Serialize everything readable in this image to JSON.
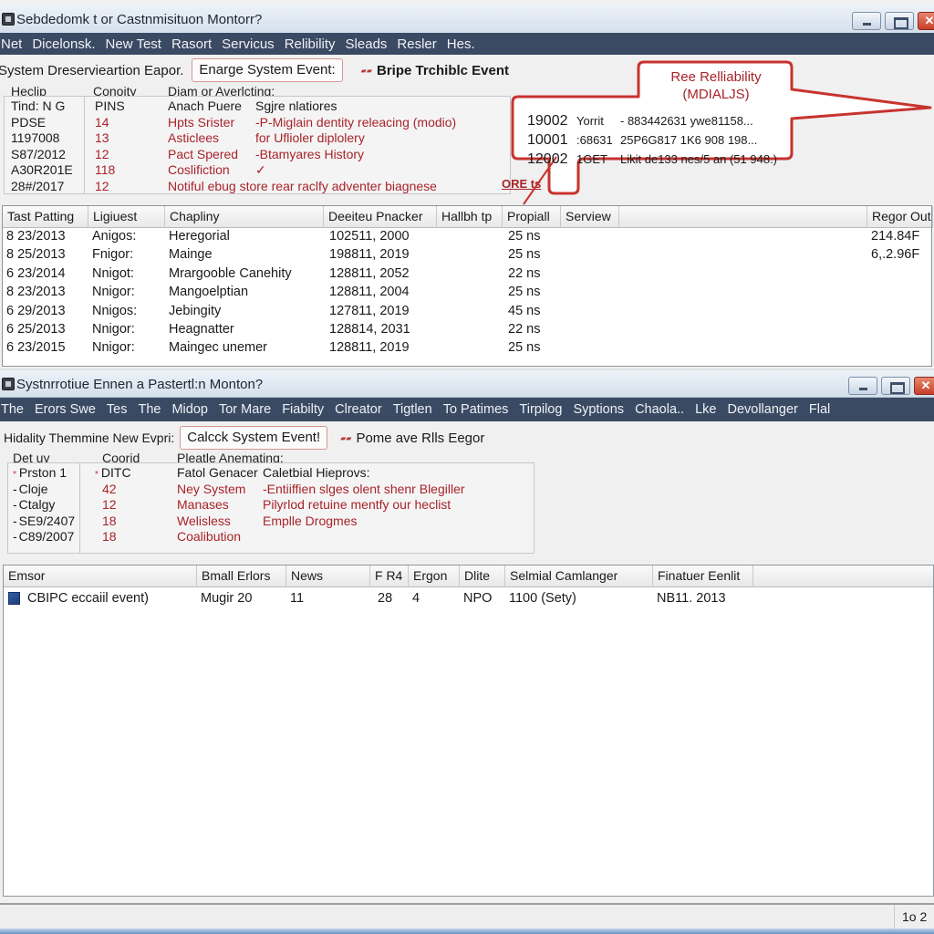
{
  "window1": {
    "title": "Sebdedomk t or Castnmisituon Montorr?",
    "menu": [
      "Net",
      "Dicelonsk.",
      "New Test",
      "Rasort",
      "Servicus",
      "Relibility",
      "Sleads",
      "Resler",
      "Hes."
    ],
    "toolbar": {
      "label": "System Dreservieartion Eapor.",
      "button": "Enarge System Event:",
      "link": "Bripe Trchiblc Event"
    },
    "summary": {
      "headers": [
        "Heclip",
        "Conoity",
        "Diam or Averlcting:"
      ],
      "rows": [
        {
          "c1": "Tind: N G",
          "c2": "PINS",
          "c3": "Anach Puere",
          "c4": "Sgjre nlatiores",
          "red": false
        },
        {
          "c1": "PDSE",
          "c2": "14",
          "c3": "Hpts Srister",
          "c4": "-P-Miglain dentity releacing (modio)",
          "red": true
        },
        {
          "c1": "1197008",
          "c2": "13",
          "c3": "Asticlees",
          "c4": "for Uflioler diplolery",
          "red": true
        },
        {
          "c1": "S87/2012",
          "c2": "12",
          "c3": "Pact Spered",
          "c4": "-Btamyares History",
          "red": true
        },
        {
          "c1": "A30R201E",
          "c2": "118",
          "c3": "Coslifiction",
          "c4": "✓",
          "red": true
        },
        {
          "c1": "28#/2017",
          "c2": "12",
          "c3": "Notiful ebug store rear raclfy adventer biagnese",
          "c4": "",
          "red": true
        }
      ],
      "link_text": "ORE ts"
    },
    "callout": {
      "title": "Ree Relliability",
      "subtitle": "(MDIALJS)",
      "lines": [
        {
          "id": "19002",
          "a": "Yorrit",
          "b": "- 883442631 ywe81158..."
        },
        {
          "id": "10001",
          "a": ":68631",
          "b": "25P6G817 1K6 908 198..."
        },
        {
          "id": "12002",
          "a": "1GET",
          "b": "Likit de133 nes/5 an (51 948.)"
        }
      ]
    },
    "table": {
      "columns": [
        "Tast Patting",
        "Ligiuest",
        "Chapliny",
        "Deeiteu Pnacker",
        "Hallbh tp",
        "Propiall",
        "Serview",
        "",
        "Regor Out"
      ],
      "rows": [
        [
          "8 23/2013",
          "Anigos:",
          "Heregorial",
          "102511, 2000",
          "",
          "25 ns",
          "",
          "",
          "214.84F"
        ],
        [
          "8 25/2013",
          "Fnigor:",
          "Mainge",
          "198811, 2019",
          "",
          "25 ns",
          "",
          "",
          "6,.2.96F"
        ],
        [
          "6 23/2014",
          "Nnigot:",
          "Mrargooble Canehity",
          "128811, 2052",
          "",
          "22 ns",
          "",
          "",
          ""
        ],
        [
          "8 23/2013",
          "Nnigor:",
          "Mangoelptian",
          "128811, 2004",
          "",
          "25 ns",
          "",
          "",
          ""
        ],
        [
          "6 29/2013",
          "Nnigos:",
          "Jebingity",
          "127811, 2019",
          "",
          "45 ns",
          "",
          "",
          ""
        ],
        [
          "6 25/2013",
          "Nnigor:",
          "Heagnatter",
          "128814, 2031",
          "",
          "22 ns",
          "",
          "",
          ""
        ],
        [
          "6 23/2015",
          "Nnigor:",
          "Maingec unemer",
          "128811, 2019",
          "",
          "25 ns",
          "",
          "",
          ""
        ]
      ]
    }
  },
  "window2": {
    "title": "Systnrrotiue Ennen a Pastertl:n Monton?",
    "menu": [
      "The",
      "Erors Swe",
      "Tes",
      "The",
      "Midop",
      "Tor Mare",
      "Fiabilty",
      "Clreator",
      "Tigtlen",
      "To Patimes",
      "Tirpilog",
      "Syptions",
      "Chaola..",
      "Lke",
      "Devollanger",
      "Flal"
    ],
    "toolbar": {
      "label": "Hidality Themmine New Evpri:",
      "button": "Calcck System Event!",
      "link": "Pome ave Rlls Eegor"
    },
    "summary": {
      "headers": [
        "Det uy",
        "Coorid",
        "Pleatle Anemating:"
      ],
      "rows": [
        {
          "c1": "Prston 1",
          "c1_bullet": "*",
          "c2": "DITC",
          "c2_bullet": "*",
          "c3": "Fatol Genacer",
          "c4": "Caletbial Hieprovs:",
          "red": false
        },
        {
          "c1": "Cloje",
          "c1_bullet": "-",
          "c2": "42",
          "c2_bullet": "",
          "c3": "Ney System",
          "c4": "-Entiiffien slges olent shenr Blegiller",
          "red": true
        },
        {
          "c1": "Ctalgy",
          "c1_bullet": "-",
          "c2": "12",
          "c2_bullet": "",
          "c3": "Manases",
          "c4": "Pilyrlod retuine mentfy our heclist",
          "red": true
        },
        {
          "c1": "SE9/2407",
          "c1_bullet": "-",
          "c2": "18",
          "c2_bullet": "",
          "c3": "Welisless",
          "c4": "Emplle Drogmes",
          "red": true
        },
        {
          "c1": "C89/2007",
          "c1_bullet": "-",
          "c2": "18",
          "c2_bullet": "",
          "c3": "Coalibution",
          "c4": "",
          "red": true
        }
      ]
    },
    "table": {
      "columns": [
        "Emsor",
        "Bmall Erlors",
        "News",
        "F R4",
        "Ergon",
        "Dlite",
        "Selmial Camlanger",
        "Finatuer Eenlit"
      ],
      "rows": [
        [
          "CBIPC eccaiil event)",
          "Mugir 20",
          "11",
          "28",
          "4",
          "NPO",
          "1100 (Sety)",
          "NB11. 2013"
        ]
      ]
    }
  },
  "statusbar": {
    "page": "1o 2"
  },
  "colors": {
    "menubar": "#3b4a63",
    "accent_red": "#c8332e",
    "text_red": "#a8232a"
  }
}
